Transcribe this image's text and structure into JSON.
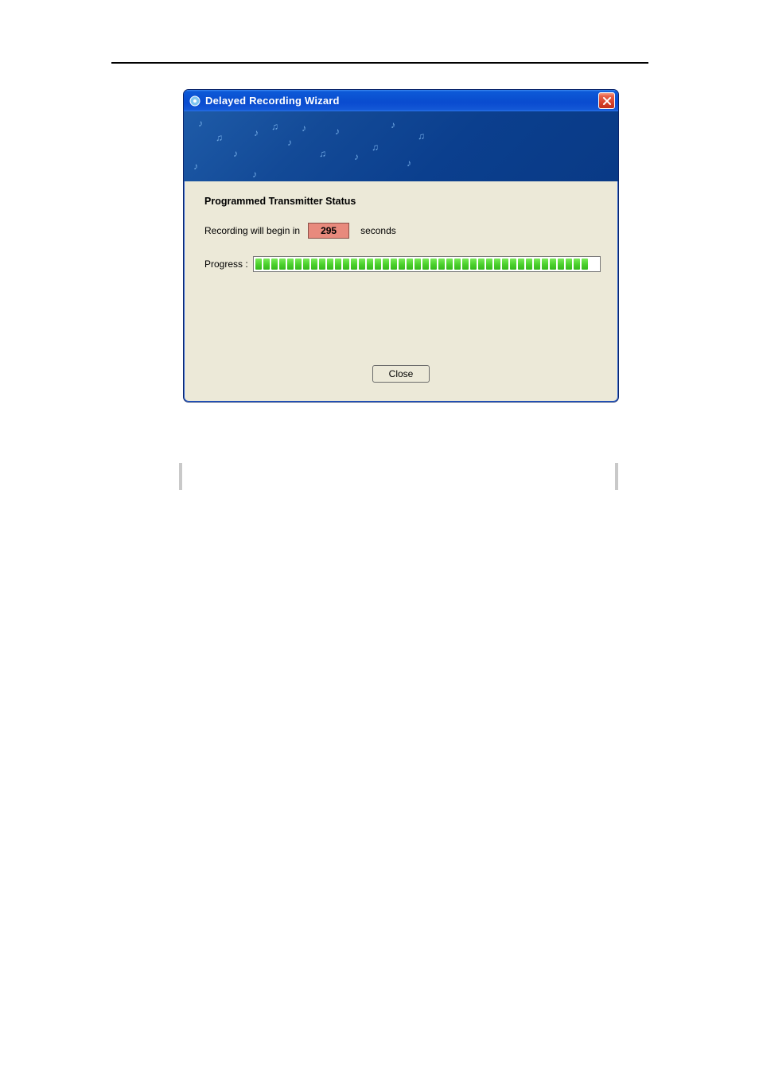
{
  "dialog": {
    "title": "Delayed Recording Wizard",
    "close_icon_name": "close-icon",
    "section_title": "Programmed Transmitter Status",
    "countdown": {
      "prefix": "Recording will begin in",
      "value": "295",
      "suffix": "seconds"
    },
    "progress": {
      "label": "Progress :",
      "segments": 42
    },
    "close_button_label": "Close"
  }
}
